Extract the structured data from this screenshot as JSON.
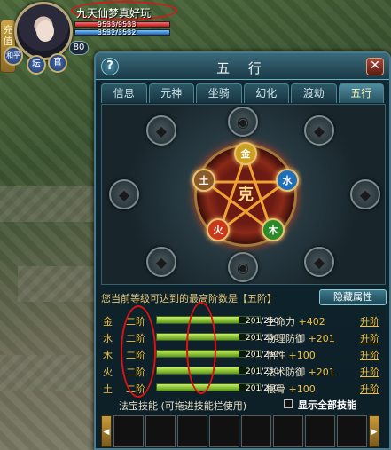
{
  "hud": {
    "side_label": "充值",
    "player_name": "九天仙梦真好玩",
    "hp_text": "9533/9533",
    "mp_text": "3532/3532",
    "level": "80",
    "badge_left": "和平",
    "badge_mid": "坛",
    "badge_right": "官"
  },
  "panel": {
    "title": "五 行",
    "help": "?",
    "close": "✕",
    "tabs": [
      "信息",
      "元神",
      "坐骑",
      "幻化",
      "渡劫",
      "五行"
    ],
    "active_tab_index": 5,
    "center_glyph": "克",
    "elements": [
      "金",
      "水",
      "木",
      "火",
      "土"
    ],
    "info_text": "您当前等级可达到的最高阶数是【五阶】",
    "hide_button": "隐藏属性",
    "rows": [
      {
        "element": "金",
        "tier": "二阶",
        "progress": "201/250",
        "fraction": 0.804,
        "attr": "生命力",
        "bonus": "+402",
        "up": "升阶"
      },
      {
        "element": "水",
        "tier": "二阶",
        "progress": "201/250",
        "fraction": 0.804,
        "attr": "物理防御",
        "bonus": "+201",
        "up": "升阶"
      },
      {
        "element": "木",
        "tier": "二阶",
        "progress": "201/250",
        "fraction": 0.804,
        "attr": "悟性",
        "bonus": "+100",
        "up": "升阶"
      },
      {
        "element": "火",
        "tier": "二阶",
        "progress": "201/250",
        "fraction": 0.804,
        "attr": "法术防御",
        "bonus": "+201",
        "up": "升阶"
      },
      {
        "element": "土",
        "tier": "二阶",
        "progress": "201/250",
        "fraction": 0.804,
        "attr": "根骨",
        "bonus": "+100",
        "up": "升阶"
      }
    ],
    "skills_label": "法宝技能 (可拖进技能栏使用)",
    "show_all": "显示全部技能",
    "arrow_left": "◀",
    "arrow_right": "▶"
  },
  "colors": {
    "accent": "#f0c040",
    "annotation": "#e01010"
  }
}
